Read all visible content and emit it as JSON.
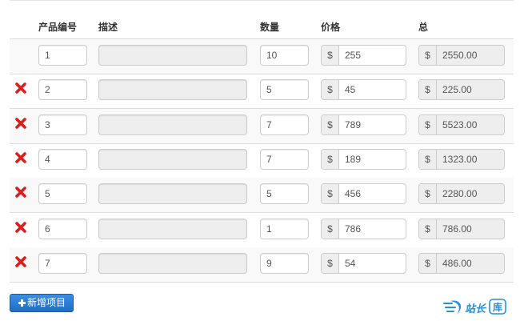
{
  "table": {
    "headers": {
      "product_id": "产品编号",
      "description": "描述",
      "quantity": "数量",
      "price": "价格",
      "total": "总"
    },
    "currency_symbol": "$",
    "delete_icon_color": "#e01b1b",
    "rows": [
      {
        "product_id": "1",
        "description": "",
        "quantity": "10",
        "price": "255",
        "total": "2550.00",
        "deletable": false
      },
      {
        "product_id": "2",
        "description": "",
        "quantity": "5",
        "price": "45",
        "total": "225.00",
        "deletable": true
      },
      {
        "product_id": "3",
        "description": "",
        "quantity": "7",
        "price": "789",
        "total": "5523.00",
        "deletable": true
      },
      {
        "product_id": "4",
        "description": "",
        "quantity": "7",
        "price": "189",
        "total": "1323.00",
        "deletable": true
      },
      {
        "product_id": "5",
        "description": "",
        "quantity": "5",
        "price": "456",
        "total": "2280.00",
        "deletable": true
      },
      {
        "product_id": "6",
        "description": "",
        "quantity": "1",
        "price": "786",
        "total": "786.00",
        "deletable": true
      },
      {
        "product_id": "7",
        "description": "",
        "quantity": "9",
        "price": "54",
        "total": "486.00",
        "deletable": true
      }
    ]
  },
  "actions": {
    "add_item_label": "新增项目",
    "add_item_color": "#2a7bd6"
  },
  "watermark": {
    "text": "站长",
    "badge_text": "库",
    "color": "#2a8fd6"
  }
}
